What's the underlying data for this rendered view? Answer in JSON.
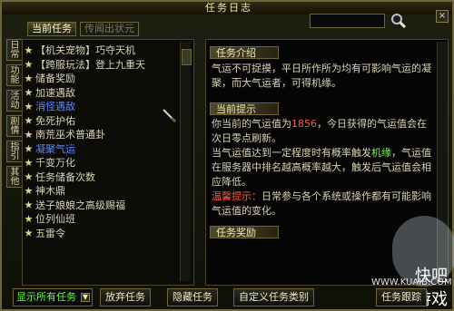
{
  "window": {
    "title": "任务日志"
  },
  "tabs": [
    {
      "label": "当前任务",
      "active": true
    },
    {
      "label": "传闻出状元",
      "active": false
    }
  ],
  "search": {
    "placeholder": ""
  },
  "left_vertical_tabs": [
    {
      "label": "日常"
    },
    {
      "label": "功能"
    },
    {
      "label": "活动"
    },
    {
      "label": "剧情"
    },
    {
      "label": "指引"
    },
    {
      "label": "其他"
    }
  ],
  "quest_list": [
    {
      "label": "【机关宠物】巧夺天机",
      "selected": false
    },
    {
      "label": "【跨服玩法】登上九重天",
      "selected": false
    },
    {
      "label": "储备奖励",
      "selected": false
    },
    {
      "label": "加速遇敌",
      "selected": false
    },
    {
      "label": "消怪遇敌",
      "selected": true
    },
    {
      "label": "免死护佑",
      "selected": false
    },
    {
      "label": "南荒巫术普通卦",
      "selected": false
    },
    {
      "label": "凝聚气运",
      "selected": true
    },
    {
      "label": "千变万化",
      "selected": false
    },
    {
      "label": "任务储备次数",
      "selected": false
    },
    {
      "label": "神木鼎",
      "selected": false
    },
    {
      "label": "送子娘娘之高级赐福",
      "selected": false
    },
    {
      "label": "位列仙班",
      "selected": false
    },
    {
      "label": "五雷令",
      "selected": false
    }
  ],
  "right_panel": {
    "task_intro": {
      "title": "任务介绍",
      "text": "气运不可捉摸，平日所作所为均有可影响气运的凝聚，而大气运者，可得机缘。"
    },
    "current_tips": {
      "title": "当前提示",
      "line1_prefix": "你当前的气运值为",
      "line1_value": "1856",
      "line1_suffix": "，今日获得的气运值会在次日零点刷新。",
      "line2_prefix": "当气运值达到一定程度时有概率触发",
      "line2_highlight": "机缘",
      "line2_suffix": "，气运值在服务器中排名越高概率越大，触发后气运值会相应降低。",
      "warning_label": "温馨提示：",
      "warning_text": "日常参与各个系统或操作都有可能影响气运值的变化。"
    },
    "task_reward": {
      "title": "任务奖励"
    }
  },
  "bottom_controls": {
    "show_all": "显示所有任务",
    "abandon": "放弃任务",
    "hide": "隐藏任务",
    "custom_category": "自定义任务类别",
    "task_tracking": "任务跟踪"
  },
  "watermark": {
    "brand": "快吧游戏",
    "site": "WWW.KUAIB.COM"
  },
  "colors": {
    "accent_red": "#ff5a3e",
    "accent_green": "#79ff41",
    "selected_blue": "#5d86ff"
  }
}
